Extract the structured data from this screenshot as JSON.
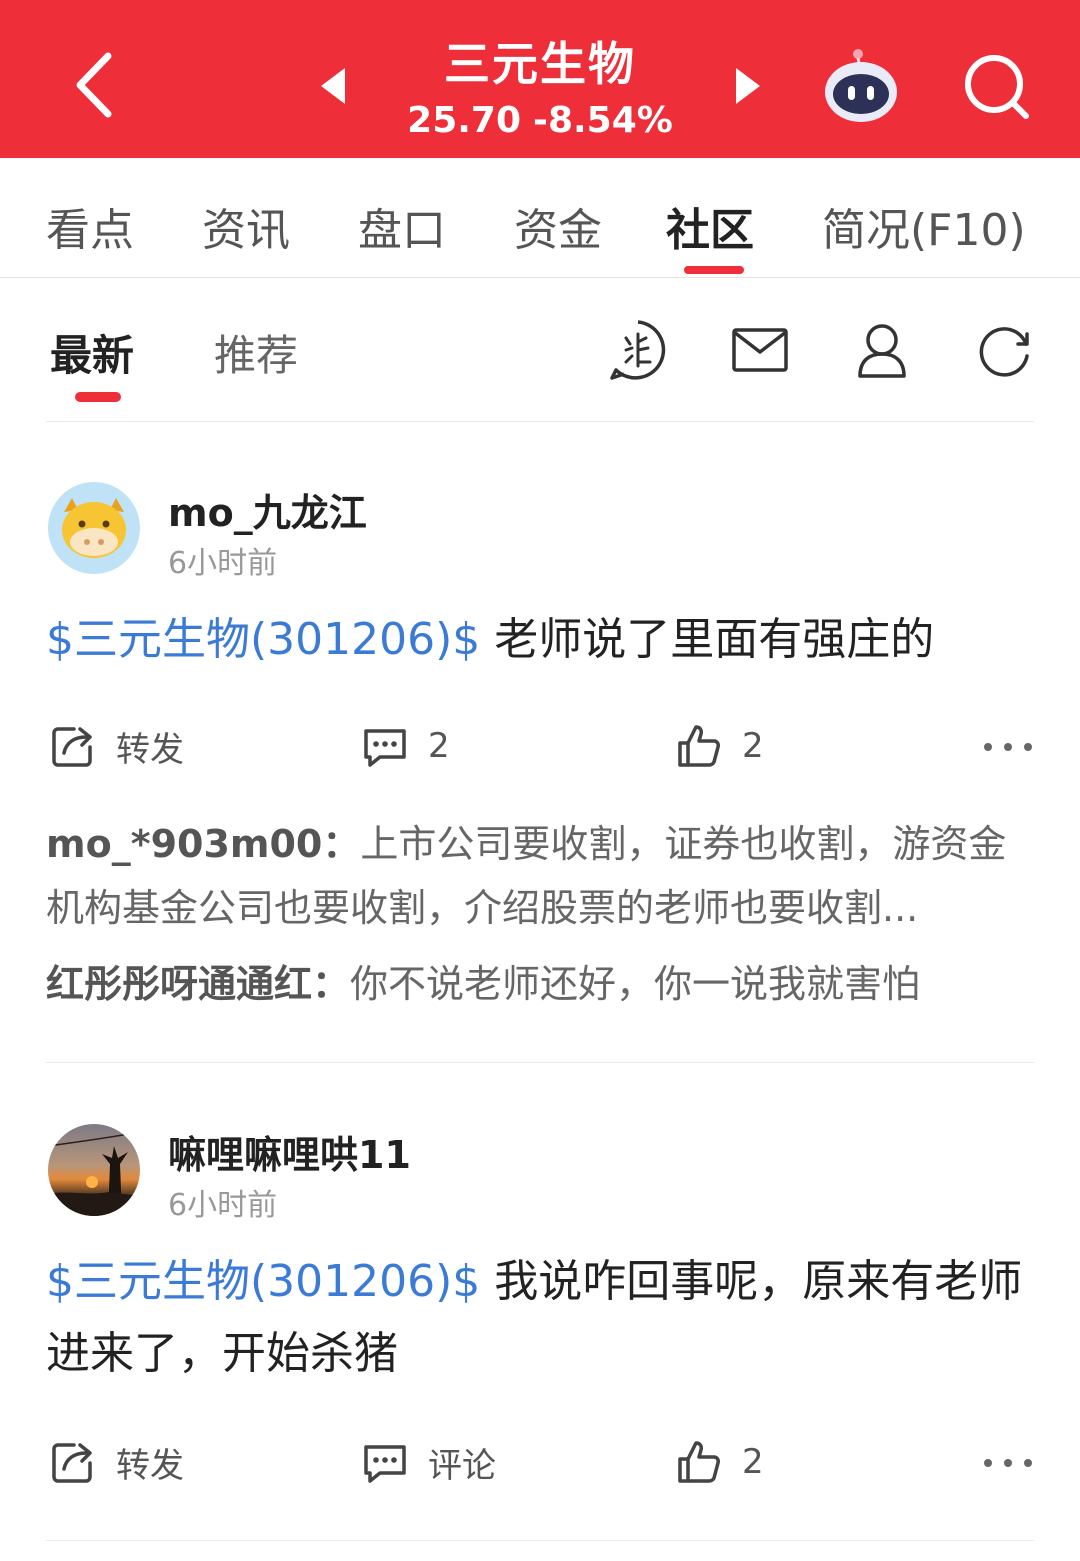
{
  "header": {
    "stock_name": "三元生物",
    "price": "25.70",
    "change_pct": "-8.54%",
    "bg_color": "#ee2e38"
  },
  "tabs": [
    {
      "label": "看点"
    },
    {
      "label": "资讯"
    },
    {
      "label": "盘口"
    },
    {
      "label": "资金"
    },
    {
      "label": "社区",
      "active": true
    },
    {
      "label": "简况(F10)"
    }
  ],
  "subtabs": [
    {
      "label": "最新",
      "active": true
    },
    {
      "label": "推荐"
    }
  ],
  "toolbar_icons": [
    "community-badge-icon",
    "mail-icon",
    "user-icon",
    "refresh-icon"
  ],
  "posts": [
    {
      "author": "mo_九龙江",
      "time": "6小时前",
      "stock_tag": "$三元生物(301206)$",
      "text": " 老师说了里面有强庄的",
      "actions": {
        "forward": "转发",
        "comments": "2",
        "likes": "2"
      },
      "comments": [
        {
          "author": "mo_*903m00：",
          "text": "上市公司要收割，证券也收割，游资金机构基金公司也要收割，介绍股票的老师也要收割..."
        },
        {
          "author": "红彤彤呀通通红：",
          "text": "你不说老师还好，你一说我就害怕"
        }
      ]
    },
    {
      "author": "嘛哩嘛哩哄11",
      "time": "6小时前",
      "stock_tag": "$三元生物(301206)$",
      "text": " 我说咋回事呢，原来有老师进来了，开始杀猪",
      "actions": {
        "forward": "转发",
        "comments": "评论",
        "likes": "2"
      }
    }
  ],
  "colors": {
    "accent": "#ee2e38",
    "link": "#3b7bd6"
  }
}
